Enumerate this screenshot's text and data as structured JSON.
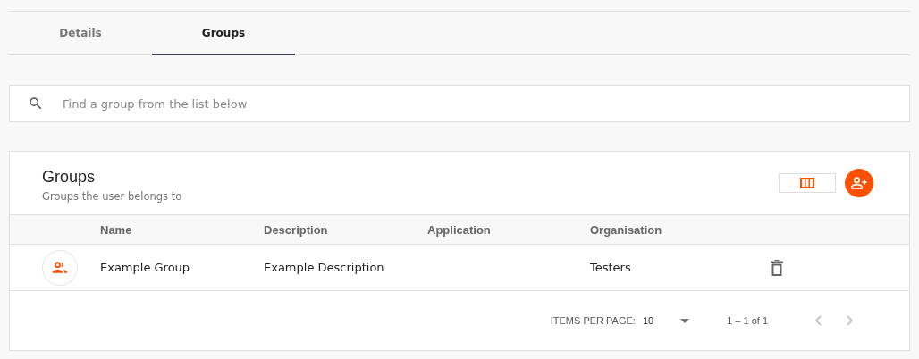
{
  "tabs": [
    {
      "label": "Details",
      "selected": false
    },
    {
      "label": "Groups",
      "selected": true
    }
  ],
  "search": {
    "placeholder": "Find a group from the list below"
  },
  "card": {
    "title": "Groups",
    "subtitle": "Groups the user belongs to"
  },
  "table": {
    "columns": [
      "Name",
      "Description",
      "Application",
      "Organisation"
    ],
    "rows": [
      {
        "name": "Example Group",
        "description": "Example Description",
        "application": "",
        "organisation": "Testers"
      }
    ]
  },
  "paginator": {
    "label": "ITEMS PER PAGE:",
    "page_size": "10",
    "range": "1 – 1 of 1"
  }
}
